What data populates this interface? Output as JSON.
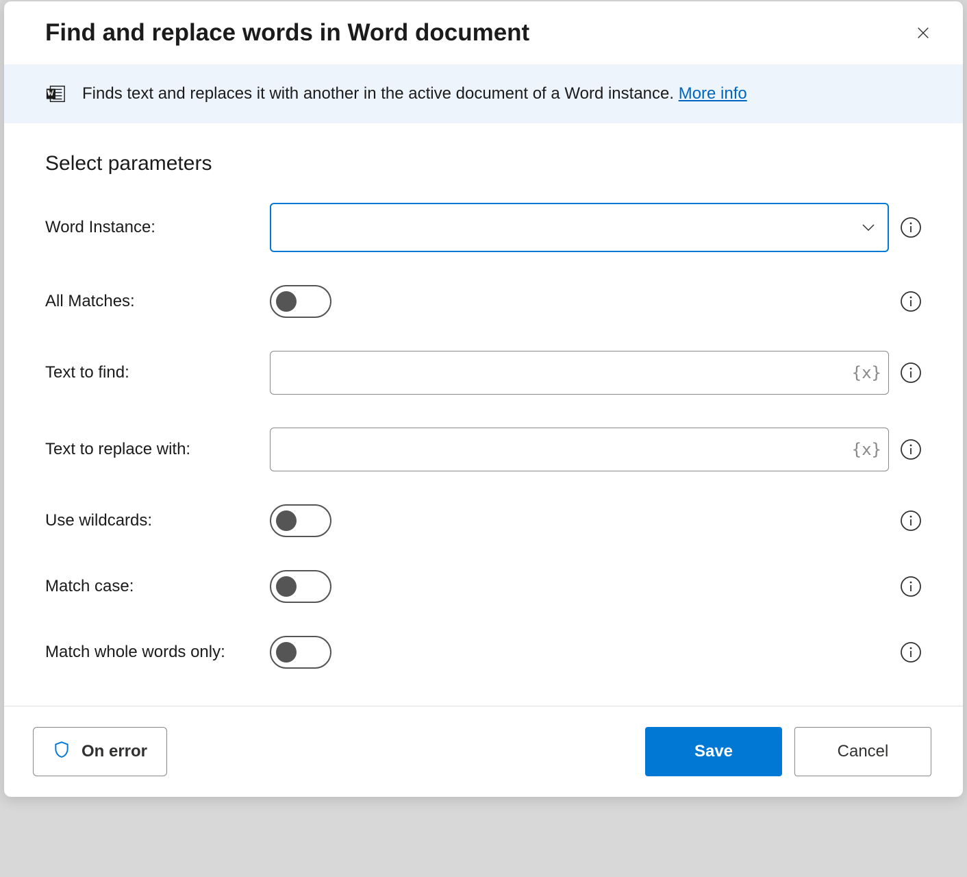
{
  "dialog": {
    "title": "Find and replace words in Word document",
    "info_text": "Finds text and replaces it with another in the active document of a Word instance. ",
    "more_info_label": "More info"
  },
  "section": {
    "heading": "Select parameters"
  },
  "params": {
    "word_instance": {
      "label": "Word Instance:",
      "value": ""
    },
    "all_matches": {
      "label": "All Matches:",
      "value": false
    },
    "text_to_find": {
      "label": "Text to find:",
      "value": ""
    },
    "text_to_replace": {
      "label": "Text to replace with:",
      "value": ""
    },
    "use_wildcards": {
      "label": "Use wildcards:",
      "value": false
    },
    "match_case": {
      "label": "Match case:",
      "value": false
    },
    "match_whole_words": {
      "label": "Match whole words only:",
      "value": false
    }
  },
  "footer": {
    "on_error_label": "On error",
    "save_label": "Save",
    "cancel_label": "Cancel"
  },
  "variable_placeholder": "{x}"
}
